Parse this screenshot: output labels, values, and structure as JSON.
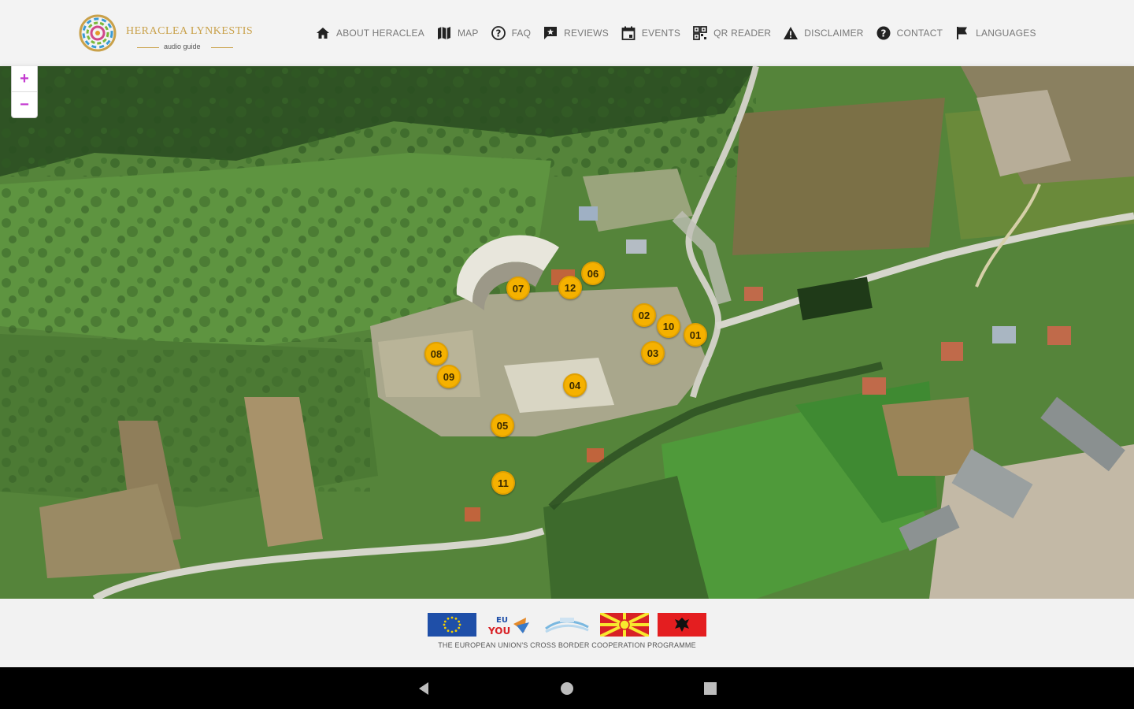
{
  "header": {
    "logo_title": "HERACLEA LYNKESTIS",
    "logo_subtitle": "audio guide"
  },
  "nav": [
    {
      "label": "ABOUT HERACLEA",
      "icon": "home-icon"
    },
    {
      "label": "MAP",
      "icon": "map-icon"
    },
    {
      "label": "FAQ",
      "icon": "question-circle-icon"
    },
    {
      "label": "REVIEWS",
      "icon": "review-icon"
    },
    {
      "label": "EVENTS",
      "icon": "calendar-icon"
    },
    {
      "label": "QR READER",
      "icon": "qr-icon"
    },
    {
      "label": "DISCLAIMER",
      "icon": "warning-icon"
    },
    {
      "label": "CONTACT",
      "icon": "help-icon"
    },
    {
      "label": "LANGUAGES",
      "icon": "flag-icon"
    }
  ],
  "map": {
    "zoom_in": "+",
    "zoom_out": "−",
    "markers": [
      "01",
      "02",
      "03",
      "04",
      "05",
      "06",
      "07",
      "08",
      "09",
      "10",
      "11",
      "12"
    ]
  },
  "footer": {
    "programme_text": "THE EUROPEAN UNION'S CROSS BORDER COOPERATION PROGRAMME",
    "logos": [
      "eu-flag-icon",
      "eu-for-you-logo",
      "interreg-logo",
      "north-macedonia-flag-icon",
      "albania-flag-icon"
    ],
    "colors": {
      "eu_blue": "#1f4fa8",
      "eu_gold": "#f5d000",
      "mk_red": "#d82126",
      "mk_yellow": "#f8e92e",
      "al_red": "#e41e20"
    }
  },
  "system_nav": [
    "back-button",
    "home-button",
    "recents-button"
  ],
  "colors": {
    "marker": "#f5b100",
    "accent": "#c43bd0",
    "logo_gold": "#c9a14a"
  }
}
